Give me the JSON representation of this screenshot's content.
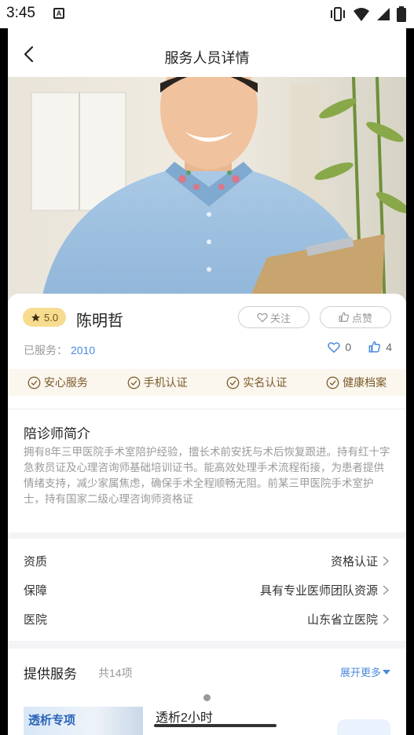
{
  "status_bar": {
    "time": "3:45",
    "notification_letter": "A"
  },
  "header": {
    "title": "服务人员详情"
  },
  "profile": {
    "rating": "5.0",
    "name": "陈明哲",
    "follow_label": "关注",
    "like_label": "点赞",
    "served_label": "已服务：",
    "served_count": "2010",
    "favorites_count": "0",
    "likes_count": "4"
  },
  "badges": [
    {
      "label": "安心服务"
    },
    {
      "label": "手机认证"
    },
    {
      "label": "实名认证"
    },
    {
      "label": "健康档案"
    }
  ],
  "intro": {
    "title": "陪诊师简介",
    "text": "拥有8年三甲医院手术室陪护经验，擅长术前安抚与术后恢复跟进。持有红十字急救员证及心理咨询师基础培训证书。能高效处理手术流程衔接，为患者提供情绪支持，减少家属焦虑，确保手术全程顺畅无阻。前某三甲医院手术室护士，持有国家二级心理咨询师资格证"
  },
  "details": [
    {
      "key": "资质",
      "value": "资格认证"
    },
    {
      "key": "保障",
      "value": "具有专业医师团队资源"
    },
    {
      "key": "医院",
      "value": "山东省立医院"
    }
  ],
  "services": {
    "title": "提供服务",
    "count": "共14项",
    "more_label": "展开更多",
    "items": [
      {
        "image_label": "透析专项",
        "title": "透析2小时"
      }
    ]
  },
  "colors": {
    "accent": "#4a89dc",
    "rating_bg": "#f7dc8f",
    "badge_text": "#7a5a2a"
  }
}
